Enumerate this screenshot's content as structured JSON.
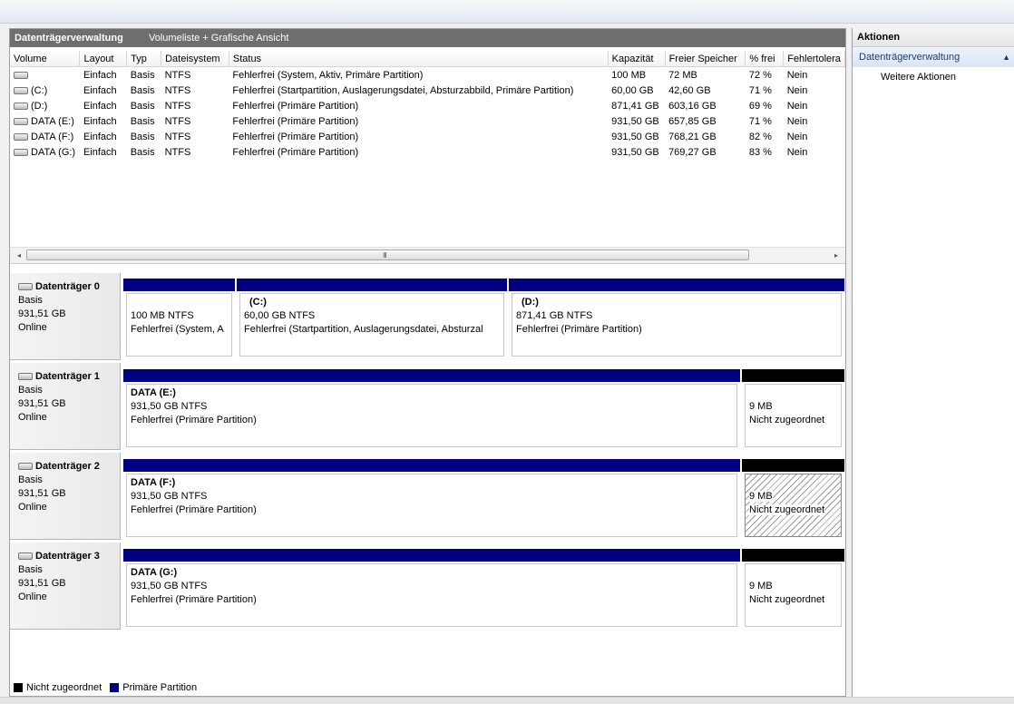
{
  "header": {
    "title": "Datenträgerverwaltung",
    "view": "Volumeliste + Grafische Ansicht"
  },
  "columns": [
    "Volume",
    "Layout",
    "Typ",
    "Dateisystem",
    "Status",
    "Kapazität",
    "Freier Speicher",
    "% frei",
    "Fehlertolera"
  ],
  "rows": [
    [
      "",
      "Einfach",
      "Basis",
      "NTFS",
      "Fehlerfrei (System, Aktiv, Primäre Partition)",
      "100 MB",
      "72 MB",
      "72 %",
      "Nein"
    ],
    [
      "(C:)",
      "Einfach",
      "Basis",
      "NTFS",
      "Fehlerfrei (Startpartition, Auslagerungsdatei, Absturzabbild, Primäre Partition)",
      "60,00 GB",
      "42,60 GB",
      "71 %",
      "Nein"
    ],
    [
      "(D:)",
      "Einfach",
      "Basis",
      "NTFS",
      "Fehlerfrei (Primäre Partition)",
      "871,41 GB",
      "603,16 GB",
      "69 %",
      "Nein"
    ],
    [
      "DATA (E:)",
      "Einfach",
      "Basis",
      "NTFS",
      "Fehlerfrei (Primäre Partition)",
      "931,50 GB",
      "657,85 GB",
      "71 %",
      "Nein"
    ],
    [
      "DATA (F:)",
      "Einfach",
      "Basis",
      "NTFS",
      "Fehlerfrei (Primäre Partition)",
      "931,50 GB",
      "768,21 GB",
      "82 %",
      "Nein"
    ],
    [
      "DATA (G:)",
      "Einfach",
      "Basis",
      "NTFS",
      "Fehlerfrei (Primäre Partition)",
      "931,50 GB",
      "769,27 GB",
      "83 %",
      "Nein"
    ]
  ],
  "scroll": {
    "left": "◂",
    "grip": "III",
    "right": "▸"
  },
  "disks": [
    {
      "name": "Datenträger 0",
      "type": "Basis",
      "size": "931,51 GB",
      "state": "Online",
      "parts": [
        {
          "name": "",
          "size": "100 MB NTFS",
          "status": "Fehlerfrei (System, A"
        },
        {
          "name": "(C:)",
          "size": "60,00 GB NTFS",
          "status": "Fehlerfrei (Startpartition, Auslagerungsdatei, Absturzal"
        },
        {
          "name": "(D:)",
          "size": "871,41 GB NTFS",
          "status": "Fehlerfrei (Primäre Partition)"
        }
      ]
    },
    {
      "name": "Datenträger 1",
      "type": "Basis",
      "size": "931,51 GB",
      "state": "Online",
      "parts": [
        {
          "name": "DATA  (E:)",
          "size": "931,50 GB NTFS",
          "status": "Fehlerfrei (Primäre Partition)"
        },
        {
          "name": "",
          "size": "9 MB",
          "status": "Nicht zugeordnet"
        }
      ]
    },
    {
      "name": "Datenträger 2",
      "type": "Basis",
      "size": "931,51 GB",
      "state": "Online",
      "parts": [
        {
          "name": "DATA  (F:)",
          "size": "931,50 GB NTFS",
          "status": "Fehlerfrei (Primäre Partition)"
        },
        {
          "name": "",
          "size": "9 MB",
          "status": "Nicht zugeordnet"
        }
      ]
    },
    {
      "name": "Datenträger 3",
      "type": "Basis",
      "size": "931,51 GB",
      "state": "Online",
      "parts": [
        {
          "name": "DATA  (G:)",
          "size": "931,50 GB NTFS",
          "status": "Fehlerfrei (Primäre Partition)"
        },
        {
          "name": "",
          "size": "9 MB",
          "status": "Nicht zugeordnet"
        }
      ]
    }
  ],
  "legend": {
    "unalloc": "Nicht zugeordnet",
    "primary": "Primäre Partition",
    "unalloc_color": "#000000",
    "primary_color": "#000080"
  },
  "actions": {
    "title": "Aktionen",
    "section": "Datenträgerverwaltung",
    "collapse_glyph": "▲",
    "more": "Weitere Aktionen"
  }
}
